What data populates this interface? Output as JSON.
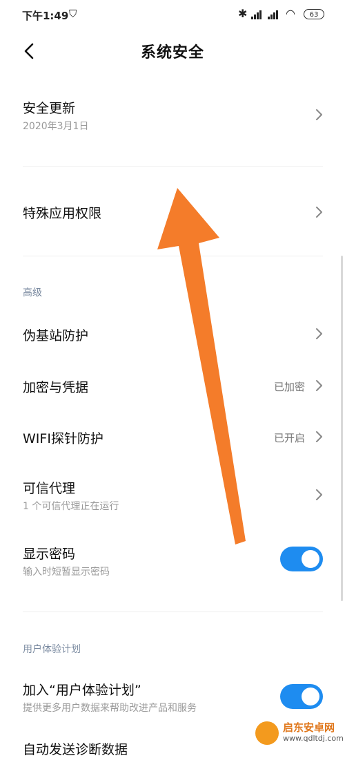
{
  "status_bar": {
    "time": "下午1:49",
    "battery": "63",
    "icons": [
      "shield-icon",
      "bluetooth-icon",
      "signal-hd-icon",
      "signal-hd-icon",
      "wifi-icon",
      "battery-icon"
    ]
  },
  "header": {
    "title": "系统安全",
    "back_icon": "chevron-left-icon"
  },
  "items": {
    "security_update": {
      "label": "安全更新",
      "sub": "2020年3月1日"
    },
    "special_permissions": {
      "label": "特殊应用权限"
    },
    "advanced_section": "高级",
    "fake_base_station": {
      "label": "伪基站防护"
    },
    "encryption": {
      "label": "加密与凭据",
      "value": "已加密"
    },
    "wifi_probe": {
      "label": "WIFI探针防护",
      "value": "已开启"
    },
    "trust_agents": {
      "label": "可信代理",
      "sub": "1 个可信代理正在运行"
    },
    "show_password": {
      "label": "显示密码",
      "sub": "输入时短暂显示密码",
      "enabled": true
    },
    "ux_section": "用户体验计划",
    "join_ux": {
      "label": "加入“用户体验计划”",
      "sub": "提供更多用户数据来帮助改进产品和服务",
      "enabled": true
    },
    "partial_row": {
      "label": "自动发送诊断数据"
    }
  },
  "watermark": {
    "title": "启东安卓网",
    "url": "www.qdltdj.com"
  },
  "colors": {
    "accent": "#1e8cf0",
    "arrow": "#f47c2a",
    "section_text": "#7a8aa0"
  }
}
